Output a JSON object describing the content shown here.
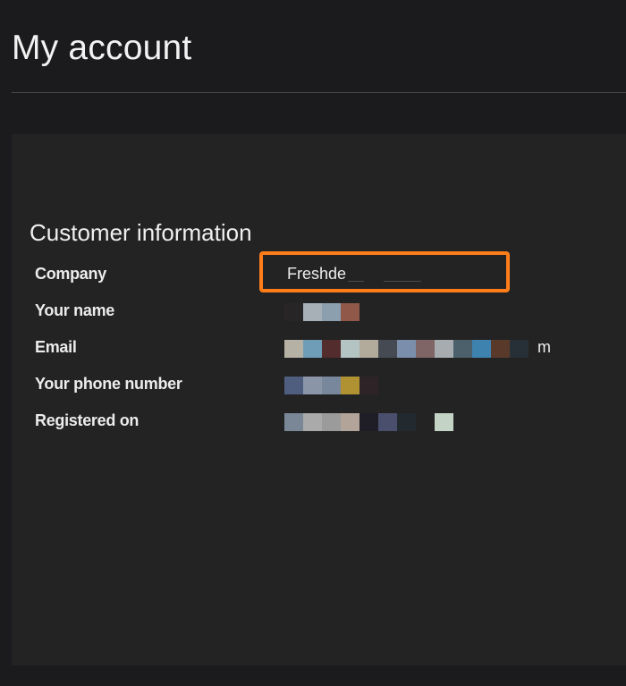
{
  "page": {
    "title": "My account"
  },
  "customer_information": {
    "section_title": "Customer information",
    "fields": {
      "company": {
        "label": "Company",
        "value": "Freshde"
      },
      "name": {
        "label": "Your name"
      },
      "email": {
        "label": "Email",
        "visible_tail": "m"
      },
      "phone": {
        "label": "Your phone number"
      },
      "registered_on": {
        "label": "Registered on"
      }
    }
  },
  "annotation": {
    "highlight_color": "#ff7e1a"
  },
  "redaction_colors": {
    "name": [
      "#282527",
      "#a7b0b6",
      "#8b9fae",
      "#8f5848"
    ],
    "email": [
      "#b6b1a5",
      "#6f9cb6",
      "#532c2d",
      "#b3c4c3",
      "#b2aa9b",
      "#454a53",
      "#7b8eab",
      "#7f6566",
      "#a7acb0",
      "#4b606b",
      "#3e82b0",
      "#593a2a",
      "#273036"
    ],
    "phone": [
      "#4f5d7e",
      "#8a96a8",
      "#78879b",
      "#b09233",
      "#2e2428"
    ],
    "registered_on": [
      "#7a8797",
      "#aaaaaa",
      "#9c9b9c",
      "#b3a499",
      "#1f1e26",
      "#4a4f6d",
      "#222a30",
      "#232323",
      "#c3d3c6"
    ]
  }
}
